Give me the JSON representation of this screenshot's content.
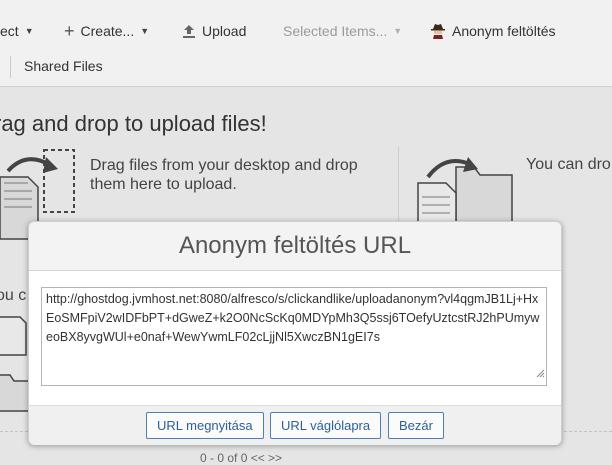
{
  "toolbar": {
    "select_label": "ect",
    "create_label": "Create...",
    "upload_label": "Upload",
    "selected_items_label": "Selected Items...",
    "anonym_label": "Anonym feltöltés"
  },
  "subbar": {
    "shared_files_label": "Shared Files"
  },
  "upload_area": {
    "title": "rag and drop to upload files!",
    "description": "Drag files from your desktop and drop them here to upload.",
    "description_right": "You can dro",
    "secondary_title": "ou c",
    "pager": "0 - 0 of 0    <<   >>"
  },
  "dialog": {
    "title": "Anonym feltöltés URL",
    "url": "http://ghostdog.jvmhost.net:8080/alfresco/s/clickandlike/uploadanonym?vl4qgmJB1Lj+HxEoSMFpiV2wIDFbPT+dGweZ+k2O0NcScKq0MDYpMh3Q5ssj6TOefyUztcstRJ2hPUmyweoBX8yvgWUl+e0naf+WewYwmLF02cLjjNl5XwczBN1gEI7s",
    "buttons": {
      "open": "URL megnyitása",
      "clipboard": "URL váglólapra",
      "close": "Bezár"
    }
  }
}
